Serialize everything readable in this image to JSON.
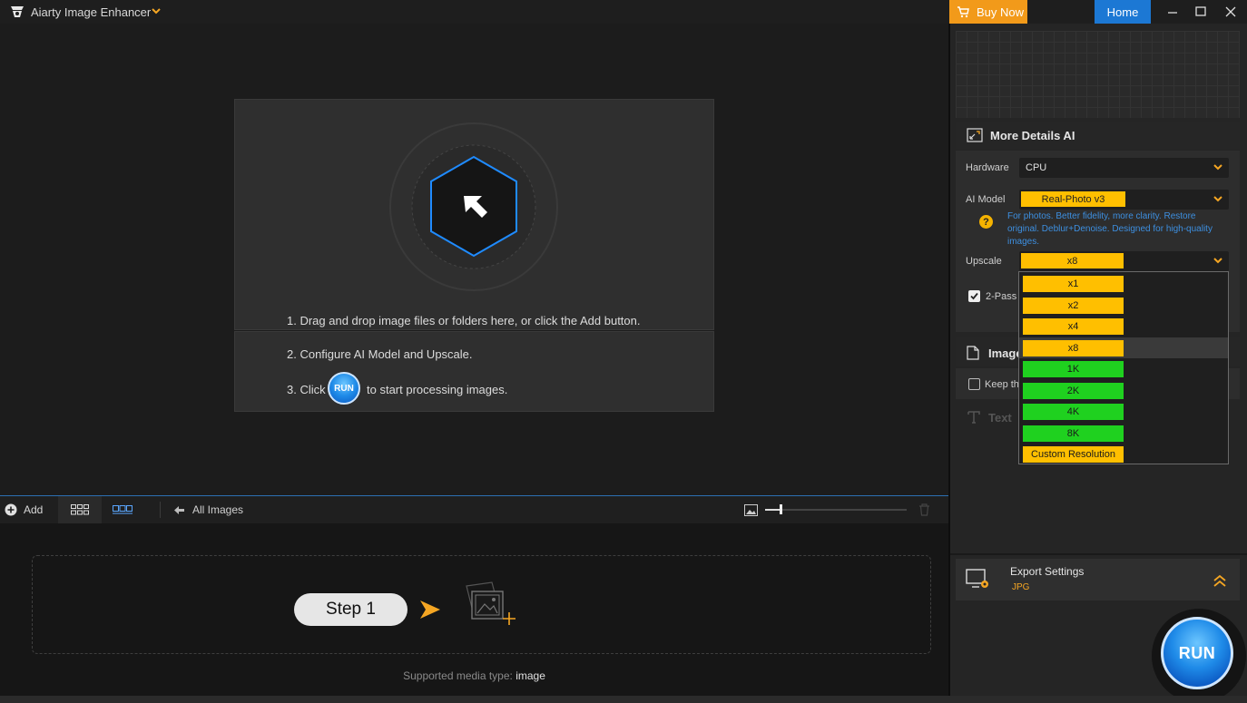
{
  "titlebar": {
    "app_title": "Aiarty Image Enhancer",
    "buy_label": "Buy Now",
    "home_label": "Home"
  },
  "instructions": {
    "step1": "1. Drag and drop image files or folders here, or click the Add button.",
    "step2": "2. Configure AI Model and Upscale.",
    "step3_prefix": "3. Click",
    "step3_suffix": "to start processing images.",
    "run_inline_label": "RUN"
  },
  "toolbar": {
    "add_label": "Add",
    "all_images_label": "All Images"
  },
  "dropzone": {
    "step_label": "Step 1",
    "supported_prefix": "Supported media type:",
    "supported_value": "image"
  },
  "panel": {
    "model_title": "More Details AI",
    "hardware_label": "Hardware",
    "hardware_value": "CPU",
    "ai_model_label": "AI Model",
    "ai_model_value": "Real-Photo v3",
    "ai_model_hint": "For photos. Better fidelity, more clarity. Restore original. Deblur+Denoise. Designed for high-quality images.",
    "upscale_label": "Upscale",
    "upscale_value": "x8",
    "two_pass_label": "2-Pass",
    "image_section_label": "Image",
    "keep_label": "Keep th",
    "text_label": "Text"
  },
  "upscale_options": [
    {
      "label": "x1",
      "color": "#ffbf00"
    },
    {
      "label": "x2",
      "color": "#ffbf00"
    },
    {
      "label": "x4",
      "color": "#ffbf00"
    },
    {
      "label": "x8",
      "color": "#ffbf00",
      "selected": true
    },
    {
      "label": "1K",
      "color": "#1fd11f"
    },
    {
      "label": "2K",
      "color": "#1fd11f"
    },
    {
      "label": "4K",
      "color": "#1fd11f"
    },
    {
      "label": "8K",
      "color": "#1fd11f"
    },
    {
      "label": "Custom Resolution",
      "color": "#ffbf00"
    }
  ],
  "export": {
    "title": "Export Settings",
    "format": "JPG"
  },
  "run_button_label": "RUN",
  "colors": {
    "accent_orange": "#f29a1a",
    "accent_blue": "#1c78d4",
    "chip_yellow": "#ffbf00",
    "chip_green": "#1fd11f"
  }
}
